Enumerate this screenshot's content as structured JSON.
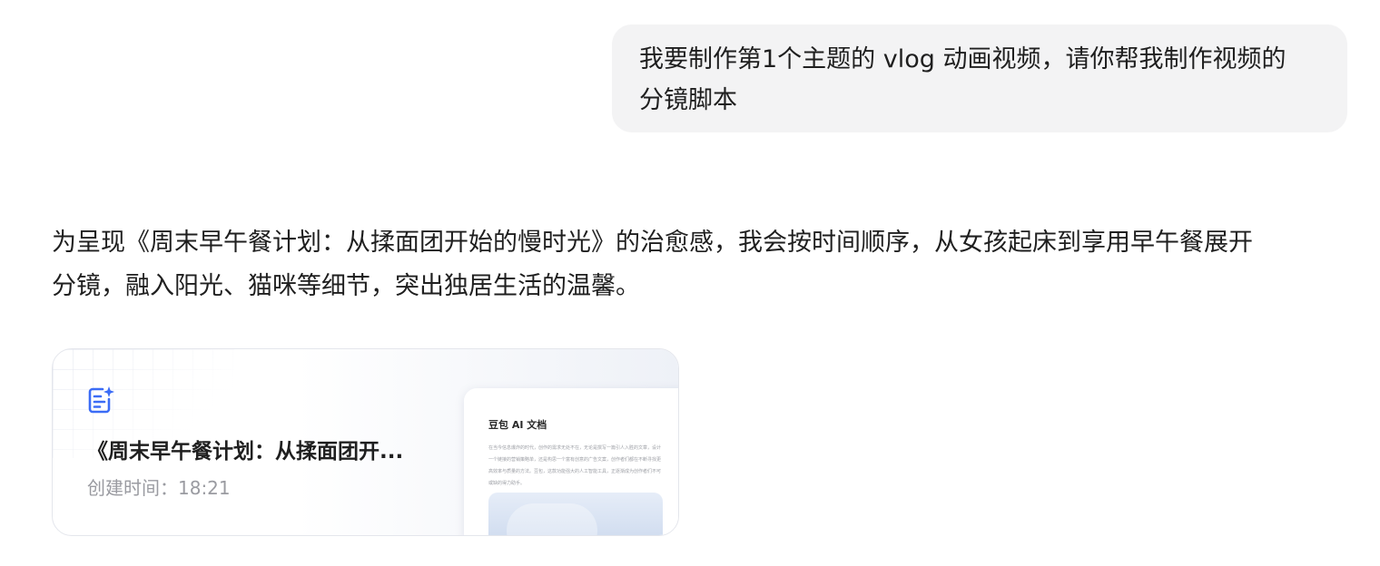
{
  "user_message": {
    "line1": "我要制作第1个主题的 vlog 动画视频，请你帮我制作视频的",
    "line2": "分镜脚本"
  },
  "assistant_message": {
    "line1": "为呈现《周末早午餐计划：从揉面团开始的慢时光》的治愈感，我会按时间顺序，从女孩起床到享用早午餐展开",
    "line2": "分镜，融入阳光、猫咪等细节，突出独居生活的温馨。"
  },
  "doc_card": {
    "icon": "ai-document-icon",
    "title": "《周末早午餐计划：从揉面团开...",
    "created_time": "创建时间：18:21",
    "preview": {
      "title": "豆包 AI 文档",
      "body": "在当今信息爆炸的时代，创作的需求无处不在，无论是撰写一篇引人入胜的文章，设计一个链接的营销策略单，还是构思一个富有创意的广告文案，创作者们都在不断寻找更高效率与质量的方法。豆包，这款功能强大的人工智能工具，正逐渐成为创作者们不可或缺的得力助手。"
    }
  },
  "colors": {
    "user_bubble_bg": "#f3f3f4",
    "icon_accent": "#3b6cf6",
    "muted_text": "#9a9ba1"
  }
}
